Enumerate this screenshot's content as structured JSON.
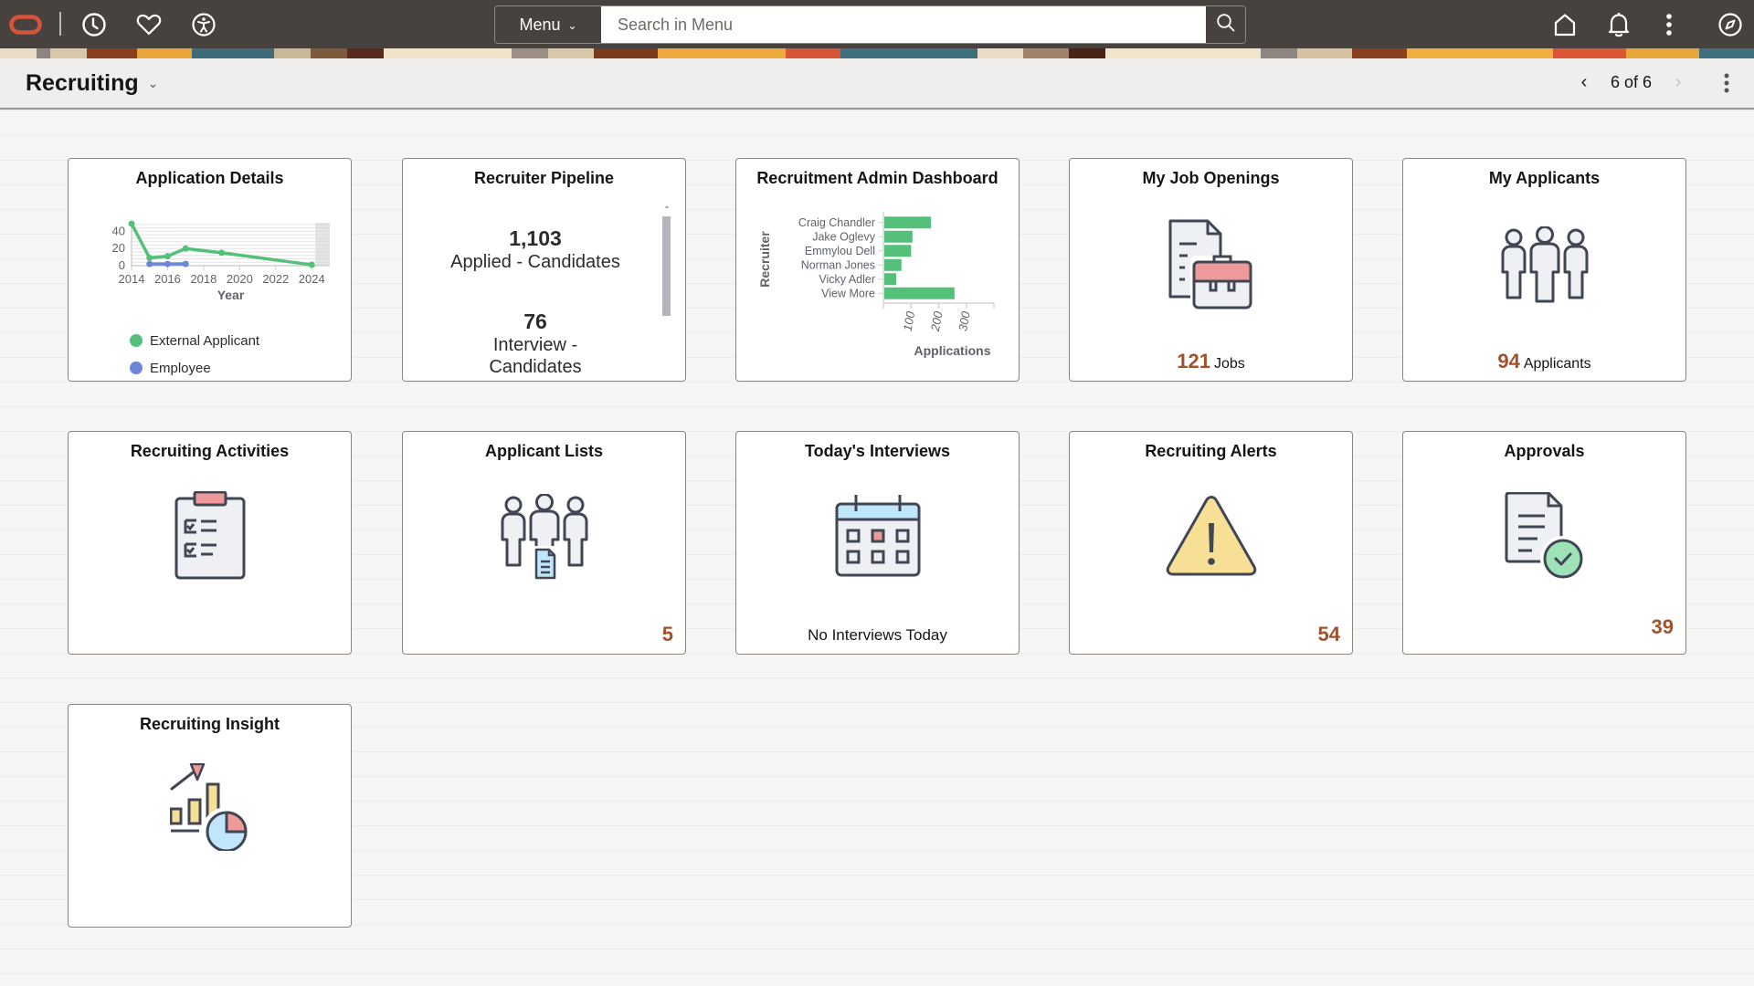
{
  "topbar": {
    "logo": "oracle-logo",
    "recent_icon": "clock-icon",
    "favorites_icon": "heart-icon",
    "accessibility_icon": "accessibility-icon",
    "menu_label": "Menu",
    "search_placeholder": "Search in Menu",
    "search_value": "",
    "home_icon": "home-icon",
    "notifications_icon": "bell-icon",
    "actions_icon": "kebab-icon",
    "navigator_icon": "compass-icon"
  },
  "pagebar": {
    "title": "Recruiting",
    "page_indicator": "6 of 6",
    "prev_icon": "chevron-left-icon",
    "next_icon": "chevron-right-icon",
    "more_icon": "kebab-icon"
  },
  "tiles": [
    {
      "title": "Application Details",
      "legend": [
        {
          "label": "External Applicant",
          "color": "#55c07a"
        },
        {
          "label": "Employee",
          "color": "#6d86d8"
        }
      ]
    },
    {
      "title": "Recruiter Pipeline",
      "items": [
        {
          "value": "1,103",
          "label": "Applied - Candidates"
        },
        {
          "value": "76",
          "label": "Interview - Candidates"
        }
      ]
    },
    {
      "title": "Recruitment Admin Dashboard"
    },
    {
      "title": "My Job Openings",
      "count": "121",
      "count_label": "Jobs",
      "icon": "job-openings-briefcase-icon"
    },
    {
      "title": "My Applicants",
      "count": "94",
      "count_label": "Applicants",
      "icon": "people-group-icon"
    },
    {
      "title": "Recruiting Activities",
      "icon": "clipboard-checklist-icon"
    },
    {
      "title": "Applicant Lists",
      "count": "5",
      "icon": "people-list-icon"
    },
    {
      "title": "Today's Interviews",
      "footer": "No Interviews Today",
      "icon": "calendar-icon"
    },
    {
      "title": "Recruiting Alerts",
      "count": "54",
      "icon": "warning-icon"
    },
    {
      "title": "Approvals",
      "count": "39",
      "icon": "document-check-icon"
    },
    {
      "title": "Recruiting Insight",
      "icon": "analytics-chart-icon"
    }
  ],
  "chart_data": [
    {
      "type": "line",
      "title": "Application Details",
      "xlabel": "Year",
      "ylabel": "",
      "x_ticks": [
        "2014",
        "2016",
        "2018",
        "2020",
        "2022",
        "2024"
      ],
      "y_ticks": [
        "0",
        "20",
        "40"
      ],
      "xlim": [
        2014,
        2025
      ],
      "ylim": [
        0,
        50
      ],
      "grid": true,
      "legend_position": "bottom",
      "series": [
        {
          "name": "External Applicant",
          "color": "#55c07a",
          "x": [
            2014,
            2015,
            2016,
            2017,
            2019,
            2024
          ],
          "y": [
            49,
            9,
            11,
            20,
            15,
            1
          ]
        },
        {
          "name": "Employee",
          "color": "#6d86d8",
          "x": [
            2015,
            2016,
            2017
          ],
          "y": [
            2,
            2,
            2
          ]
        }
      ]
    },
    {
      "type": "bar",
      "orientation": "horizontal",
      "title": "Recruitment Admin Dashboard",
      "xlabel": "Applications",
      "ylabel": "Recruiter",
      "categories": [
        "Craig Chandler",
        "Jake Oglevy",
        "Emmylou Dell",
        "Norman Jones",
        "Vicky Adler",
        "View More"
      ],
      "values": [
        169,
        102,
        97,
        62,
        43,
        254
      ],
      "x_ticks": [
        "100",
        "200",
        "300"
      ],
      "xlim": [
        0,
        400
      ],
      "color": "#55c07a"
    }
  ]
}
